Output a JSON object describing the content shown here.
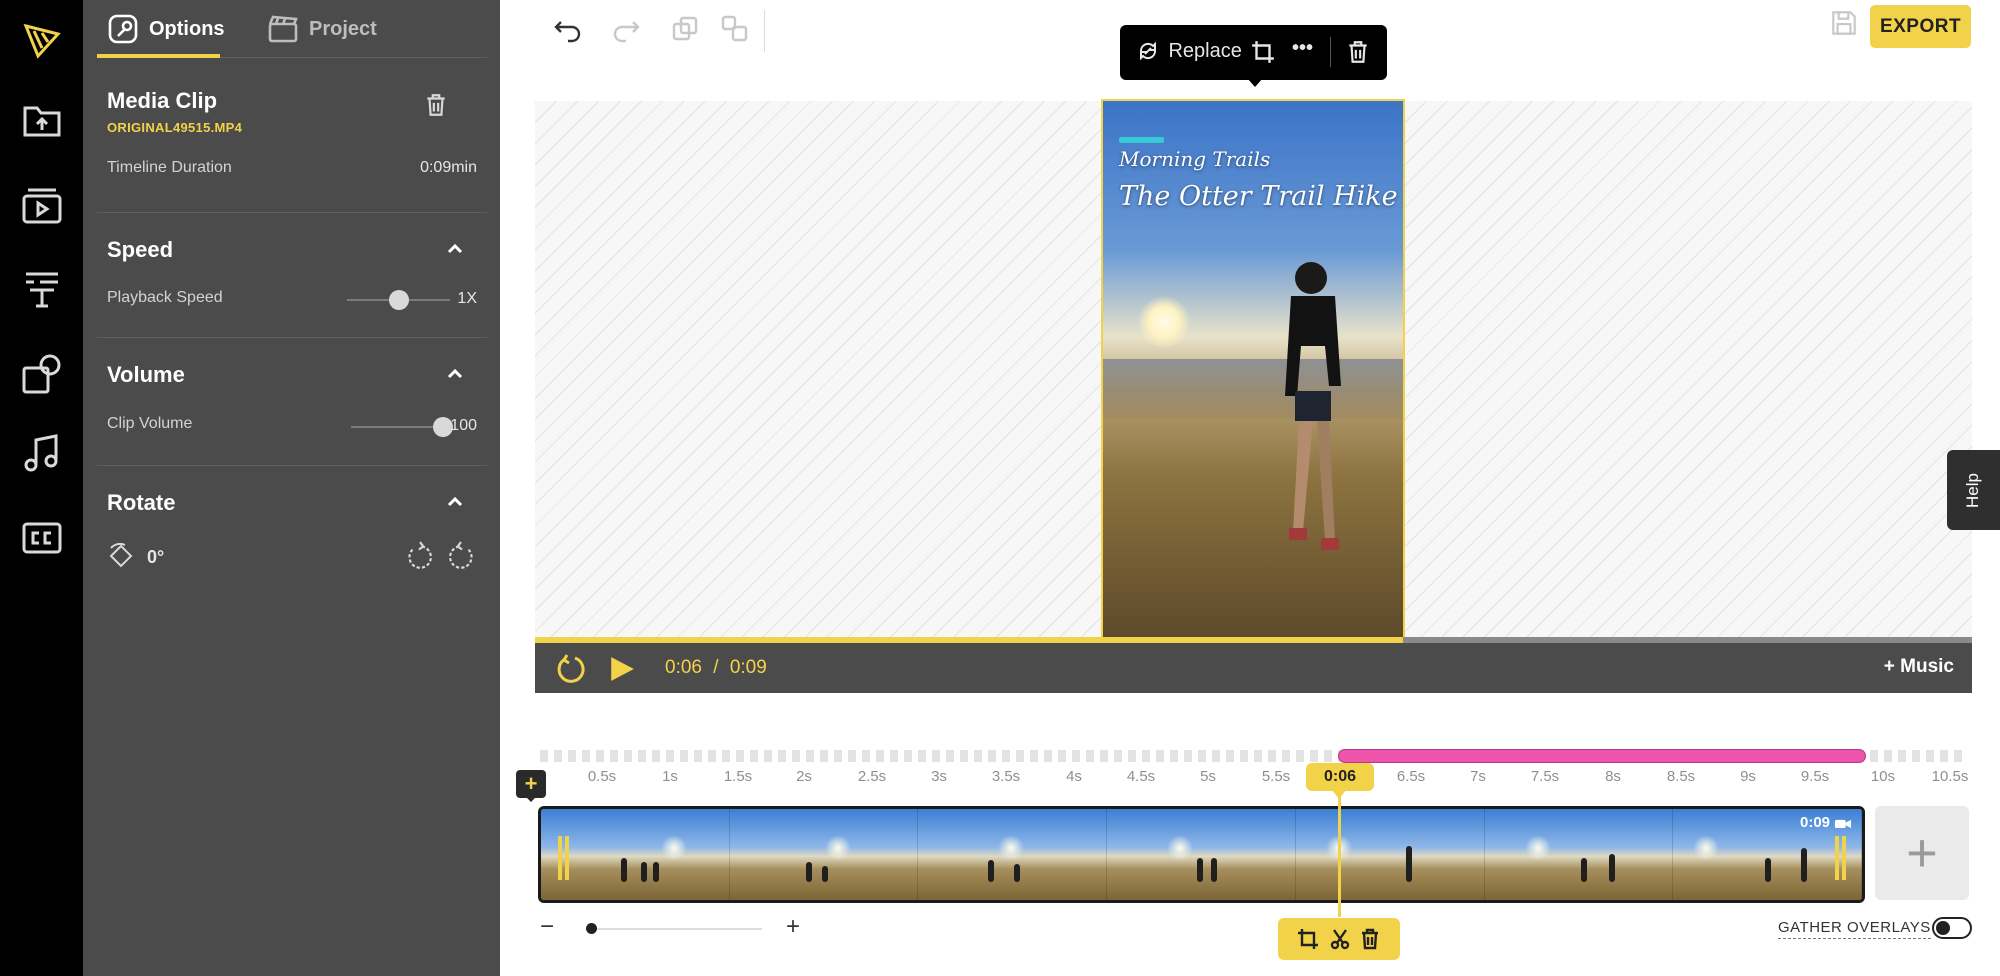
{
  "panel": {
    "tabs": [
      {
        "label": "Options",
        "icon": "wrench-icon",
        "active": true
      },
      {
        "label": "Project",
        "icon": "clapperboard-icon",
        "active": false
      }
    ],
    "clip": {
      "title": "Media Clip",
      "filename": "ORIGINAL49515.MP4",
      "duration_label": "Timeline Duration",
      "duration_value": "0:09min"
    },
    "speed": {
      "title": "Speed",
      "label": "Playback Speed",
      "value": "1X",
      "level": 0.5
    },
    "volume": {
      "title": "Volume",
      "label": "Clip Volume",
      "value": "100",
      "level": 1.0
    },
    "rotate": {
      "title": "Rotate",
      "value": "0°"
    }
  },
  "rail": {
    "items": [
      "logo-icon",
      "upload-folder-icon",
      "video-library-icon",
      "text-icon",
      "elements-icon",
      "music-icon",
      "captions-icon"
    ]
  },
  "toolbar": {
    "export_label": "EXPORT"
  },
  "context_menu": {
    "replace_label": "Replace",
    "more_label": "•••"
  },
  "video": {
    "brand": "Morning Trails",
    "title": "The Otter Trail Hike"
  },
  "player": {
    "current": "0:06",
    "separator": "/",
    "total": "0:09",
    "music_label": "+ Music",
    "progress": 0.604
  },
  "timeline": {
    "ticks": [
      "0.5s",
      "1s",
      "1.5s",
      "2s",
      "2.5s",
      "3s",
      "3.5s",
      "4s",
      "4.5s",
      "5s",
      "5.5s",
      "6.5s",
      "7s",
      "7.5s",
      "8s",
      "8.5s",
      "9s",
      "9.5s",
      "10s",
      "10.5s"
    ],
    "playhead_label": "0:06",
    "clip_duration": "0:09",
    "add_overlay_label": "+",
    "add_clip_label": "+",
    "zoom_minus": "−",
    "zoom_plus": "+",
    "gather_label": "GATHER OVERLAYS"
  },
  "help": {
    "label": "Help"
  },
  "colors": {
    "accent": "#f2d249",
    "panel": "#4b4b4b",
    "rail": "#000000",
    "overlay_bar": "#ef54ad"
  }
}
